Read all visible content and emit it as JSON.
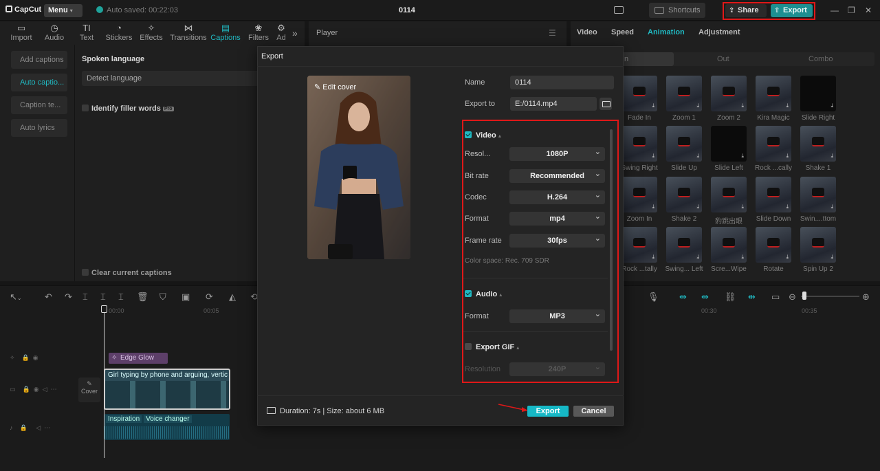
{
  "app": {
    "logo": "CapCut",
    "menu_label": "Menu",
    "autosave_text": "Auto saved: 00:22:03",
    "project_title": "0114",
    "shortcuts_label": "Shortcuts",
    "share_label": "Share",
    "export_label": "Export"
  },
  "toolbar": {
    "tools": [
      {
        "label": "Import",
        "icon": "import-icon"
      },
      {
        "label": "Audio",
        "icon": "audio-icon"
      },
      {
        "label": "Text",
        "icon": "text-icon"
      },
      {
        "label": "Stickers",
        "icon": "stickers-icon"
      },
      {
        "label": "Effects",
        "icon": "effects-icon"
      },
      {
        "label": "Transitions",
        "icon": "transitions-icon"
      },
      {
        "label": "Captions",
        "icon": "captions-icon",
        "active": true
      },
      {
        "label": "Filters",
        "icon": "filters-icon"
      },
      {
        "label": "Ad",
        "icon": "adjust-icon"
      }
    ]
  },
  "captions_panel": {
    "side_items": [
      "Add captions",
      "Auto captio...",
      "Caption te...",
      "Auto lyrics"
    ],
    "spoken_language_label": "Spoken language",
    "detect_language": "Detect language",
    "filler_words_label": "Identify filler words",
    "pro_badge": "Pro",
    "clear_captions_label": "Clear current captions"
  },
  "player": {
    "title": "Player"
  },
  "right_panel": {
    "tabs": [
      "Video",
      "Speed",
      "Animation",
      "Adjustment"
    ],
    "active_tab": "Animation",
    "subtabs": [
      "In",
      "Out",
      "Combo"
    ],
    "animation_rows": [
      [
        "Fade In",
        "Zoom 1",
        "Zoom 2",
        "Kira Magic",
        "Slide Right"
      ],
      [
        "Swing Right",
        "Slide Up",
        "Slide Left",
        "Rock ...cally",
        "Shake 1"
      ],
      [
        "Zoom In",
        "Shake 2",
        "豹跳出眼",
        "Slide Down",
        "Swin....ttom"
      ],
      [
        "Rock ...tally",
        "Swing... Left",
        "Scre...Wipe",
        "Rotate",
        "Spin Up 2"
      ]
    ]
  },
  "timeline": {
    "ruler_marks": [
      "00:00",
      "00:05",
      "00:30",
      "00:35"
    ],
    "effect_clip": "Edge Glow",
    "main_clip_caption": "Girl typing by phone and arguing, vertic",
    "cover_label": "Cover",
    "audio_labels": [
      "Inspiration",
      "Voice changer"
    ]
  },
  "export_dialog": {
    "title": "Export",
    "edit_cover": "Edit cover",
    "name_label": "Name",
    "name_value": "0114",
    "export_to_label": "Export to",
    "export_to_value": "E:/0114.mp4",
    "video_section": "Video",
    "video_settings": [
      {
        "label": "Resol...",
        "value": "1080P"
      },
      {
        "label": "Bit rate",
        "value": "Recommended"
      },
      {
        "label": "Codec",
        "value": "H.264"
      },
      {
        "label": "Format",
        "value": "mp4"
      },
      {
        "label": "Frame rate",
        "value": "30fps"
      }
    ],
    "color_space": "Color space: Rec. 709 SDR",
    "audio_section": "Audio",
    "audio_format_label": "Format",
    "audio_format_value": "MP3",
    "gif_section": "Export GIF",
    "gif_resolution_label": "Resolution",
    "gif_resolution_value": "240P",
    "duration_text": "Duration: 7s | Size: about 6 MB",
    "export_button": "Export",
    "cancel_button": "Cancel"
  },
  "colors": {
    "accent": "#20b8c1",
    "highlight_box": "#e01818",
    "export_button": "#16b8c6"
  }
}
